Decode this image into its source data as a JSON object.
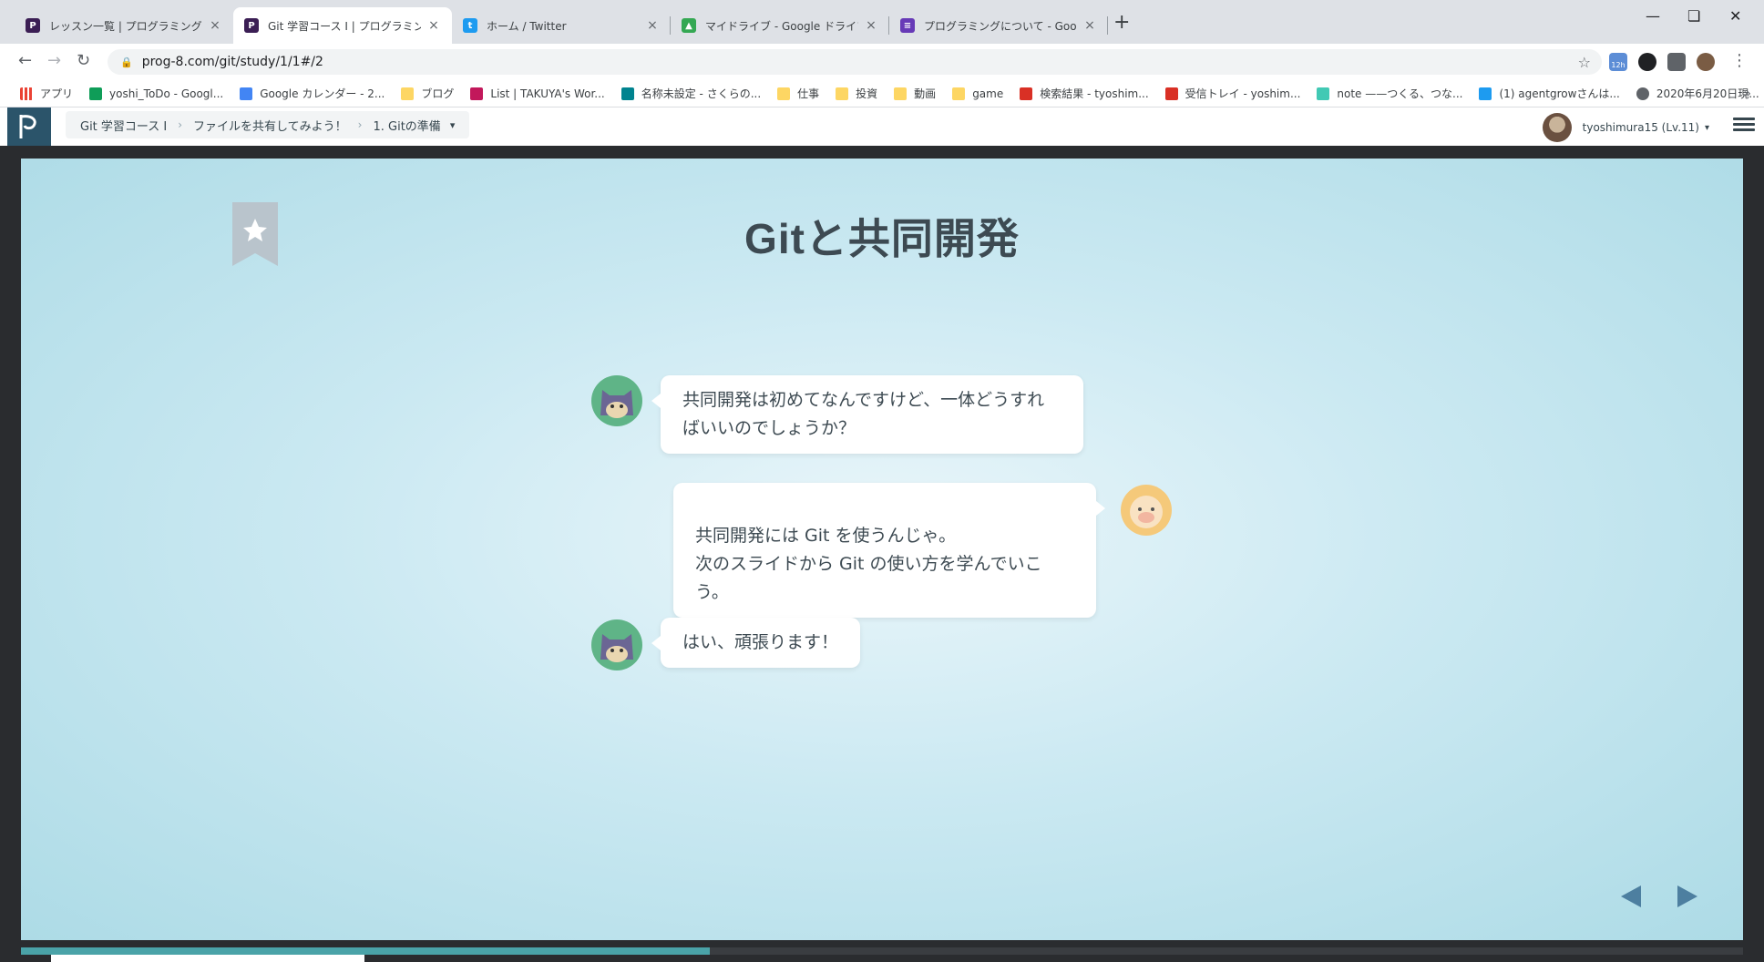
{
  "browser": {
    "tabs": [
      {
        "title": "レッスン一覧 | プログラミングの入門な",
        "favicon_color": "#3b1e54",
        "favicon_glyph": "P",
        "active": false
      },
      {
        "title": "Git 学習コース I | プログラミングの入門",
        "favicon_color": "#3b1e54",
        "favicon_glyph": "P",
        "active": true
      },
      {
        "title": "ホーム / Twitter",
        "favicon_color": "#1d9bf0",
        "favicon_glyph": "t",
        "active": false
      },
      {
        "title": "マイドライブ - Google ドライブ",
        "favicon_color": "#34a853",
        "favicon_glyph": "▲",
        "active": false
      },
      {
        "title": "プログラミングについて - Google フォー",
        "favicon_color": "#673ab7",
        "favicon_glyph": "≡",
        "active": false
      }
    ],
    "close_glyph": "×",
    "new_tab_glyph": "+",
    "url": "prog-8.com/git/study/1/1#/2",
    "extension_badge": "12h"
  },
  "bookmarks": [
    {
      "label": "アプリ",
      "color": "#ea4335"
    },
    {
      "label": "yoshi_ToDo - Googl...",
      "color": "#0f9d58"
    },
    {
      "label": "Google カレンダー - 2...",
      "color": "#4285f4"
    },
    {
      "label": "ブログ",
      "color": "#fdd663"
    },
    {
      "label": "List | TAKUYA's Wor...",
      "color": "#c2185b"
    },
    {
      "label": "名称未設定 - さくらの...",
      "color": "#00838f"
    },
    {
      "label": "仕事",
      "color": "#fdd663"
    },
    {
      "label": "投資",
      "color": "#fdd663"
    },
    {
      "label": "動画",
      "color": "#fdd663"
    },
    {
      "label": "game",
      "color": "#fdd663"
    },
    {
      "label": "検索結果 - tyoshim...",
      "color": "#d93025"
    },
    {
      "label": "受信トレイ - yoshim...",
      "color": "#d93025"
    },
    {
      "label": "note ——つくる、つな...",
      "color": "#41c9b4"
    },
    {
      "label": "(1) agentgrowさんは...",
      "color": "#1d9bf0"
    },
    {
      "label": "2020年6月20日現...",
      "color": "#5f6368"
    }
  ],
  "bookmarks_more": "»",
  "app": {
    "breadcrumb": [
      "Git 学習コース I",
      "ファイルを共有してみよう！",
      "1. Gitの準備"
    ],
    "breadcrumb_sep": "›",
    "dropdown_glyph": "▾",
    "user_label": "tyoshimura15 (Lv.11)"
  },
  "slide": {
    "title": "Gitと共同開発",
    "progress_fraction": 0.4,
    "messages": [
      {
        "speaker": "student",
        "text": "共同開発は初めてなんですけど、一体どうすればいいのでしょうか？"
      },
      {
        "speaker": "teacher",
        "text": "共同開発には Git を使うんじゃ。\n次のスライドから Git の使い方を学んでいこう。"
      },
      {
        "speaker": "student",
        "text": "はい、頑張ります！"
      }
    ]
  },
  "icons": {
    "back": "arrow-left-icon",
    "forward": "arrow-right-icon",
    "reload": "reload-icon",
    "star": "star-icon",
    "menu": "hamburger-menu-icon"
  }
}
